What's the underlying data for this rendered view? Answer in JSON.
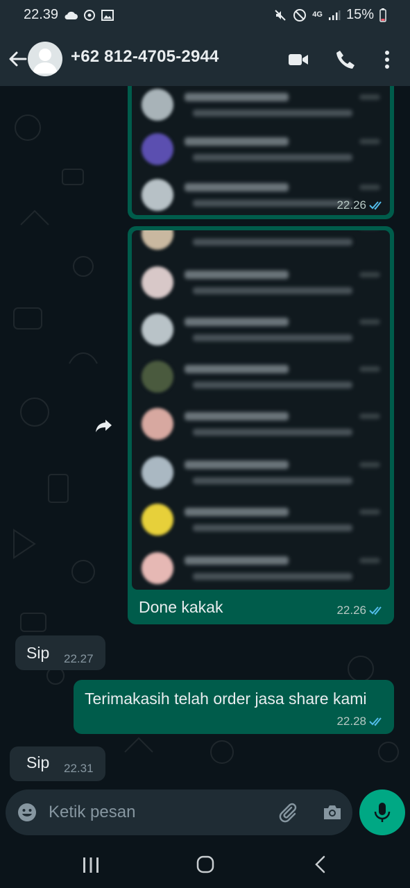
{
  "status_bar": {
    "time": "22.39",
    "network": "4G",
    "battery": "15%"
  },
  "header": {
    "contact_name": "+62 812-4705-2944"
  },
  "messages": {
    "screenshot_1_time": "22.26",
    "screenshot_2_caption": "Done kakak",
    "screenshot_2_time": "22.26",
    "reply_1_text": "Sip",
    "reply_1_time": "22.27",
    "outgoing_text": "Terimakasih telah order jasa share kami",
    "outgoing_time": "22.28",
    "reply_2_text": "Sip",
    "reply_2_time": "22.31"
  },
  "composer": {
    "placeholder": "Ketik pesan"
  },
  "colors": {
    "background": "#0b141a",
    "header": "#1f2c34",
    "outgoing_bubble": "#005c4b",
    "incoming_bubble": "#202c33",
    "accent": "#00a884",
    "read_ticks": "#53bdeb"
  },
  "icons": [
    "back-arrow-icon",
    "avatar-icon",
    "video-call-icon",
    "voice-call-icon",
    "more-options-icon",
    "forward-icon",
    "read-receipt-icon",
    "emoji-icon",
    "attach-icon",
    "camera-icon",
    "mic-icon",
    "recents-nav-icon",
    "home-nav-icon",
    "back-nav-icon"
  ]
}
